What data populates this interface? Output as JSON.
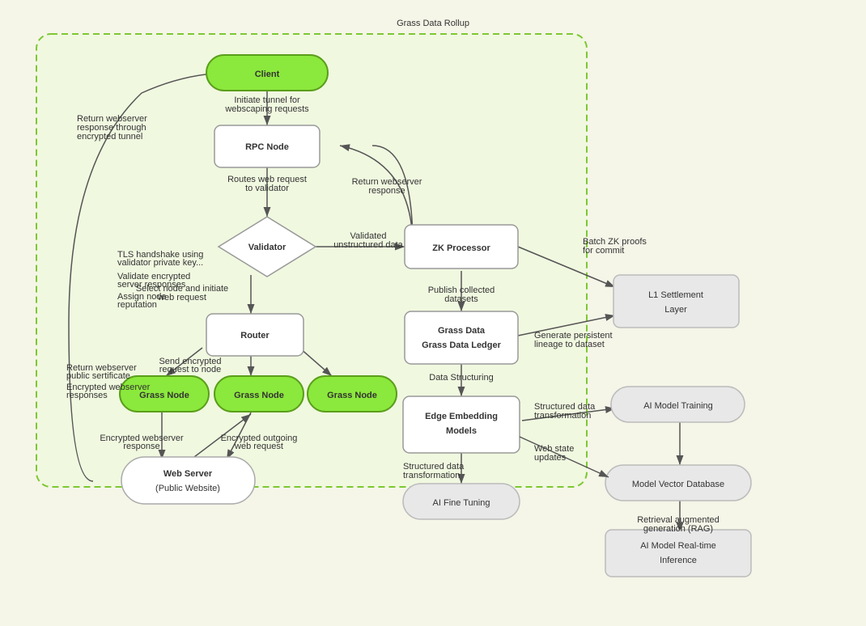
{
  "title": "Grass Data Rollup",
  "nodes": {
    "client": "Client",
    "rpc_node": "RPC Node",
    "validator": "Validator",
    "router": "Router",
    "grass_node1": "Grass Node",
    "grass_node2": "Grass Node",
    "grass_node3": "Grass Node",
    "web_server": "Web Server\n(Public Website)",
    "zk_processor": "ZK Processor",
    "grass_data_ledger": "Grass Data\nLedger",
    "edge_embedding": "Edge Embedding\nModels",
    "ai_fine_tuning": "AI Fine Tuning",
    "l1_settlement": "L1 Settlement\nLayer",
    "ai_model_training": "AI Model Training",
    "model_vector_db": "Model Vector Database",
    "ai_realtime": "AI Model Real-time\nInference"
  },
  "labels": {
    "initiate_tunnel": "Initiate tunnel for\nwebscaping requests",
    "routes_web": "Routes web request\nto validator",
    "return_webserver_response": "Return webserver\nresponse",
    "validated_unstructured": "Validated\nunstructured data",
    "select_node": "Select node and initiate\nweb request",
    "send_encrypted": "Send encrypted\nrequest to node",
    "return_webserver_public": "Return webserver\npublic sertificate",
    "encrypted_webserver": "Encrypted webserver\nresponses",
    "encrypted_outgoing": "Encrypted outgoing\nweb request",
    "encrypted_response": "Encrypted webserver\nresponse",
    "return_webserver_through": "Return webserver\nresponse through\nencrypted tunnel",
    "tls_handshake": "TLS handshake using\nvalidator private key...",
    "validate_encrypted": "Validate encrypted\nserver responses",
    "assign_node": "Assign node\nreputation",
    "publish_collected": "Publish collected\ndatasets",
    "data_structuring": "Data Structuring",
    "batch_zk": "Batch ZK proofs\nfor commit",
    "generate_persistent": "Generate persistent\nlineage to dataset",
    "structured_data_transformation": "Structured data\ntransformation",
    "structured_data_transformation2": "Structured data\ntransformation",
    "web_state_updates": "Web state\nupdates",
    "retrieval_augmented": "Retrieval augmented\ngeneration (RAG)"
  }
}
